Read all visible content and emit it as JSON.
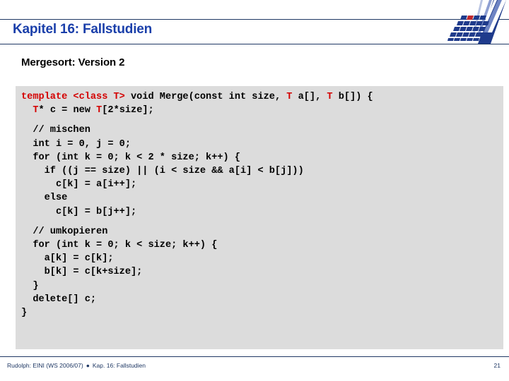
{
  "slide": {
    "title": "Kapitel 16: Fallstudien",
    "subtitle": "Mergesort: Version 2"
  },
  "logo": {
    "name": "university-logo",
    "colors": {
      "dark_blue": "#1f3b8c",
      "mid_blue": "#6f85c4",
      "light_blue": "#b9c4e2",
      "accent_red": "#c0282d",
      "white": "#ffffff"
    }
  },
  "code": {
    "language": "C++",
    "highlight_color": "#d40000",
    "text_color": "#000000",
    "background_color": "#dcdcdc",
    "lines": [
      {
        "tokens": [
          {
            "t": "template <class T>",
            "k": true
          },
          {
            "t": " void Merge(const int size, ",
            "k": false
          },
          {
            "t": "T",
            "k": true
          },
          {
            "t": " a[], ",
            "k": false
          },
          {
            "t": "T",
            "k": true
          },
          {
            "t": " b[]) {",
            "k": false
          }
        ]
      },
      {
        "tokens": [
          {
            "t": "  ",
            "k": false
          },
          {
            "t": "T",
            "k": true
          },
          {
            "t": "* c = new ",
            "k": false
          },
          {
            "t": "T",
            "k": true
          },
          {
            "t": "[2*size];",
            "k": false
          }
        ]
      },
      {
        "blank": true
      },
      {
        "tokens": [
          {
            "t": "  // mischen",
            "k": false
          }
        ]
      },
      {
        "tokens": [
          {
            "t": "  int i = 0, j = 0;",
            "k": false
          }
        ]
      },
      {
        "tokens": [
          {
            "t": "  for (int k = 0; k < 2 * size; k++) {",
            "k": false
          }
        ]
      },
      {
        "tokens": [
          {
            "t": "    if ((j == size) || (i < size && a[i] < b[j]))",
            "k": false
          }
        ]
      },
      {
        "tokens": [
          {
            "t": "      c[k] = a[i++];",
            "k": false
          }
        ]
      },
      {
        "tokens": [
          {
            "t": "    else",
            "k": false
          }
        ]
      },
      {
        "tokens": [
          {
            "t": "      c[k] = b[j++];",
            "k": false
          }
        ]
      },
      {
        "blank": true
      },
      {
        "tokens": [
          {
            "t": "  // umkopieren",
            "k": false
          }
        ]
      },
      {
        "tokens": [
          {
            "t": "  for (int k = 0; k < size; k++) {",
            "k": false
          }
        ]
      },
      {
        "tokens": [
          {
            "t": "    a[k] = c[k];",
            "k": false
          }
        ]
      },
      {
        "tokens": [
          {
            "t": "    b[k] = c[k+size];",
            "k": false
          }
        ]
      },
      {
        "tokens": [
          {
            "t": "  }",
            "k": false
          }
        ]
      },
      {
        "tokens": [
          {
            "t": "  delete[] c;",
            "k": false
          }
        ]
      },
      {
        "tokens": [
          {
            "t": "}",
            "k": false
          }
        ]
      }
    ]
  },
  "footer": {
    "author_course": "Rudolph: EINI (WS 2006/07)",
    "bullet": "●",
    "chapter": "Kap. 16: Fallstudien",
    "page_number": "21"
  }
}
